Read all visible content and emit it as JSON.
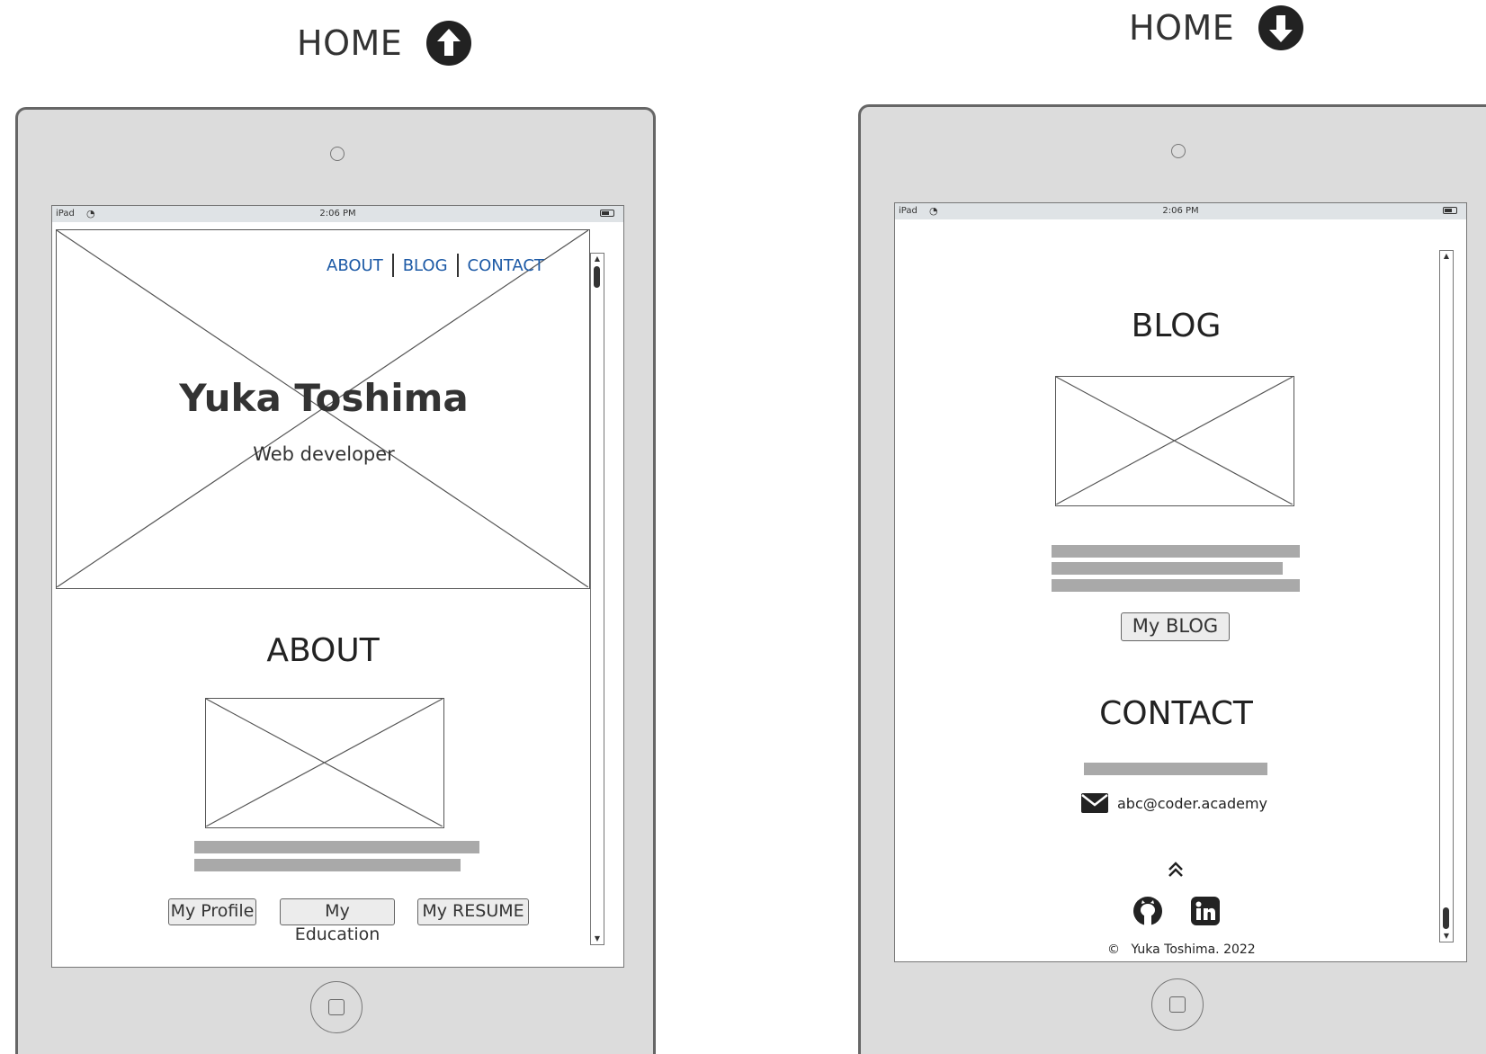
{
  "left_page": {
    "label": "HOME",
    "arrow_icon": "arrow-up-circle-icon",
    "status": {
      "device": "iPad",
      "time": "2:06 PM"
    },
    "nav": {
      "about": "ABOUT",
      "blog": "BLOG",
      "contact": "CONTACT"
    },
    "hero": {
      "name": "Yuka Toshima",
      "subtitle": "Web developer"
    },
    "about": {
      "title": "ABOUT",
      "buttons": {
        "profile": "My Profile",
        "education": "My Education",
        "resume": "My RESUME"
      }
    }
  },
  "right_page": {
    "label": "HOME",
    "arrow_icon": "arrow-down-circle-icon",
    "status": {
      "device": "iPad",
      "time": "2:06 PM"
    },
    "blog": {
      "title": "BLOG",
      "button": "My BLOG"
    },
    "contact": {
      "title": "CONTACT",
      "email": "abc@coder.academy"
    },
    "footer": {
      "copyright_symbol": "©",
      "text": "Yuka Toshima. 2022"
    }
  },
  "colors": {
    "nav_link": "#1d5aa6",
    "tablet_body": "#dcdcdc",
    "placeholder_bar": "#a9a9a9",
    "status_bar": "#dfe3e6"
  }
}
